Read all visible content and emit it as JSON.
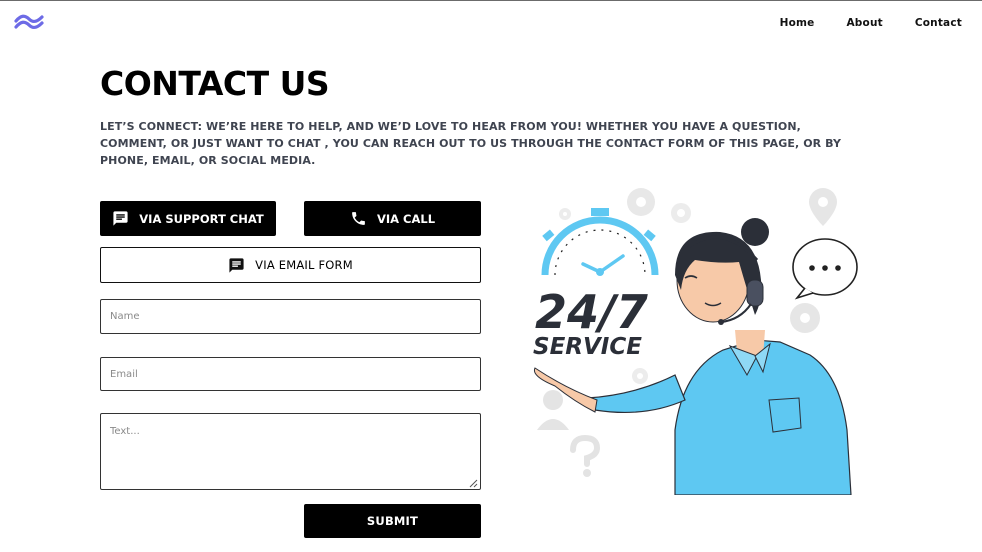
{
  "header": {
    "logo_icon": "wave-logo-icon",
    "nav": [
      {
        "label": "Home"
      },
      {
        "label": "About"
      },
      {
        "label": "Contact"
      }
    ]
  },
  "main": {
    "title": "CONTACT US",
    "subtitle": "LET’S CONNECT: WE’RE HERE TO HELP, AND WE’D LOVE TO HEAR FROM YOU! WHETHER YOU HAVE A QUESTION, COMMENT, OR JUST WANT TO CHAT , YOU CAN REACH OUT TO US THROUGH THE CONTACT FORM OF THIS PAGE, OR BY PHONE, EMAIL, OR SOCIAL MEDIA."
  },
  "actions": {
    "chat_label": "VIA SUPPORT CHAT",
    "call_label": "VIA CALL",
    "email_label": "VIA EMAIL FORM",
    "chat_icon": "chat-icon",
    "call_icon": "phone-icon",
    "email_icon": "message-icon"
  },
  "form": {
    "name_placeholder": "Name",
    "email_placeholder": "Email",
    "text_placeholder": "Text...",
    "submit_label": "SUBMIT"
  },
  "illustration": {
    "line1": "24/7",
    "line2": "SERVICE",
    "speech_text": "..."
  },
  "colors": {
    "logo": "#6d6be6",
    "accent_blue": "#5ec8f2",
    "dark_text": "#2b2f38"
  }
}
